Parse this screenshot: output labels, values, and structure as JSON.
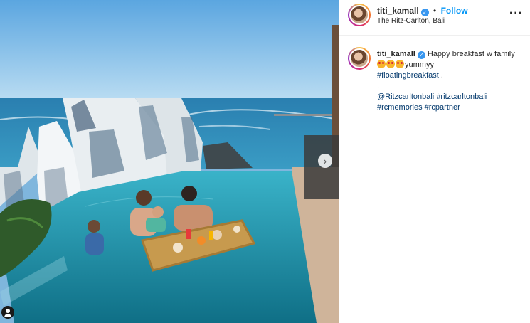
{
  "post": {
    "username": "titi_kamall",
    "verified": true,
    "follow_label": "Follow",
    "separator": "•",
    "location": "The Ritz-Carlton, Bali",
    "more_label": "···"
  },
  "caption": {
    "username": "titi_kamall",
    "text_part1": "Happy breakfast w family ",
    "emoji_name": "star-struck-emoji",
    "emoji_count": 3,
    "text_part2": "yummyy",
    "hashtag1": "#floatingbreakfast",
    "trailing": " .",
    "dot_line": ".",
    "mention": "@Ritzcarltonbali",
    "hashtag2": "#ritzcarltonbali",
    "hashtag3": "#rcmemories",
    "hashtag4": "#rcpartner"
  },
  "media": {
    "next_arrow": "›",
    "tag_icon": "user-tag-icon"
  },
  "colors": {
    "follow": "#0095f6",
    "verified": "#3897f0",
    "hashtag": "#00376b"
  }
}
